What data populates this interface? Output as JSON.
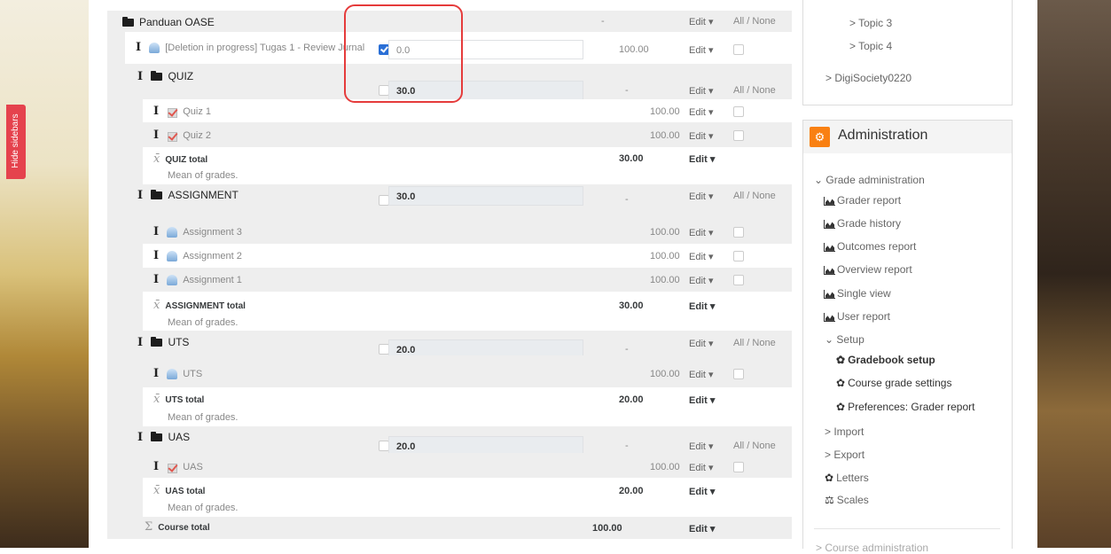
{
  "sidebar_toggle": {
    "label": "Hide sidebars"
  },
  "course": {
    "name": "Panduan OASE",
    "range": "-",
    "edit": "Edit ▾",
    "all_none": "All / None"
  },
  "items": {
    "deletion": {
      "name": "[Deletion in progress] Tugas 1 - Review Jurnal",
      "weight": "0.0",
      "range": "100.00",
      "edit": "Edit ▾"
    },
    "quiz": {
      "name": "QUIZ",
      "weight": "30.0",
      "range": "-",
      "edit": "Edit ▾",
      "all_none": "All / None"
    },
    "quiz1": {
      "name": "Quiz 1",
      "range": "100.00",
      "edit": "Edit ▾"
    },
    "quiz2": {
      "name": "Quiz 2",
      "range": "100.00",
      "edit": "Edit ▾"
    },
    "quiz_total": {
      "name": "QUIZ total",
      "desc": "Mean of grades.",
      "range": "30.00",
      "edit": "Edit ▾"
    },
    "assignment": {
      "name": "ASSIGNMENT",
      "weight": "30.0",
      "range": "-",
      "edit": "Edit ▾",
      "all_none": "All / None"
    },
    "assign3": {
      "name": "Assignment 3",
      "range": "100.00",
      "edit": "Edit ▾"
    },
    "assign2": {
      "name": "Assignment 2",
      "range": "100.00",
      "edit": "Edit ▾"
    },
    "assign1": {
      "name": "Assignment 1",
      "range": "100.00",
      "edit": "Edit ▾"
    },
    "assign_total": {
      "name": "ASSIGNMENT total",
      "desc": "Mean of grades.",
      "range": "30.00",
      "edit": "Edit ▾"
    },
    "uts": {
      "name": "UTS",
      "weight": "20.0",
      "range": "-",
      "edit": "Edit ▾",
      "all_none": "All / None"
    },
    "uts_item": {
      "name": "UTS",
      "range": "100.00",
      "edit": "Edit ▾"
    },
    "uts_total": {
      "name": "UTS total",
      "desc": "Mean of grades.",
      "range": "20.00",
      "edit": "Edit ▾"
    },
    "uas": {
      "name": "UAS",
      "weight": "20.0",
      "range": "-",
      "edit": "Edit ▾",
      "all_none": "All / None"
    },
    "uas_item": {
      "name": "UAS",
      "range": "100.00",
      "edit": "Edit ▾"
    },
    "uas_total": {
      "name": "UAS total",
      "desc": "Mean of grades.",
      "range": "20.00",
      "edit": "Edit ▾"
    },
    "course_total": {
      "name": "Course total",
      "range": "100.00",
      "edit": "Edit ▾"
    }
  },
  "nav": {
    "topic3": "> Topic 3",
    "topic4": "> Topic 4",
    "digisociety": "> DigiSociety0220"
  },
  "admin": {
    "title": "Administration",
    "grade_admin": "Grade administration",
    "grader_report": "Grader report",
    "grade_history": "Grade history",
    "outcomes_report": "Outcomes report",
    "overview_report": "Overview report",
    "single_view": "Single view",
    "user_report": "User report",
    "setup": "Setup",
    "gradebook_setup": "Gradebook setup",
    "course_grade_settings": "Course grade settings",
    "preferences": "Preferences: Grader report",
    "import": "> Import",
    "export": "> Export",
    "letters": "Letters",
    "scales": "Scales",
    "course_admin": "> Course administration"
  },
  "colors": {
    "accent": "#f98012",
    "highlight": "#e53b3b",
    "toggle": "#e5424d"
  }
}
